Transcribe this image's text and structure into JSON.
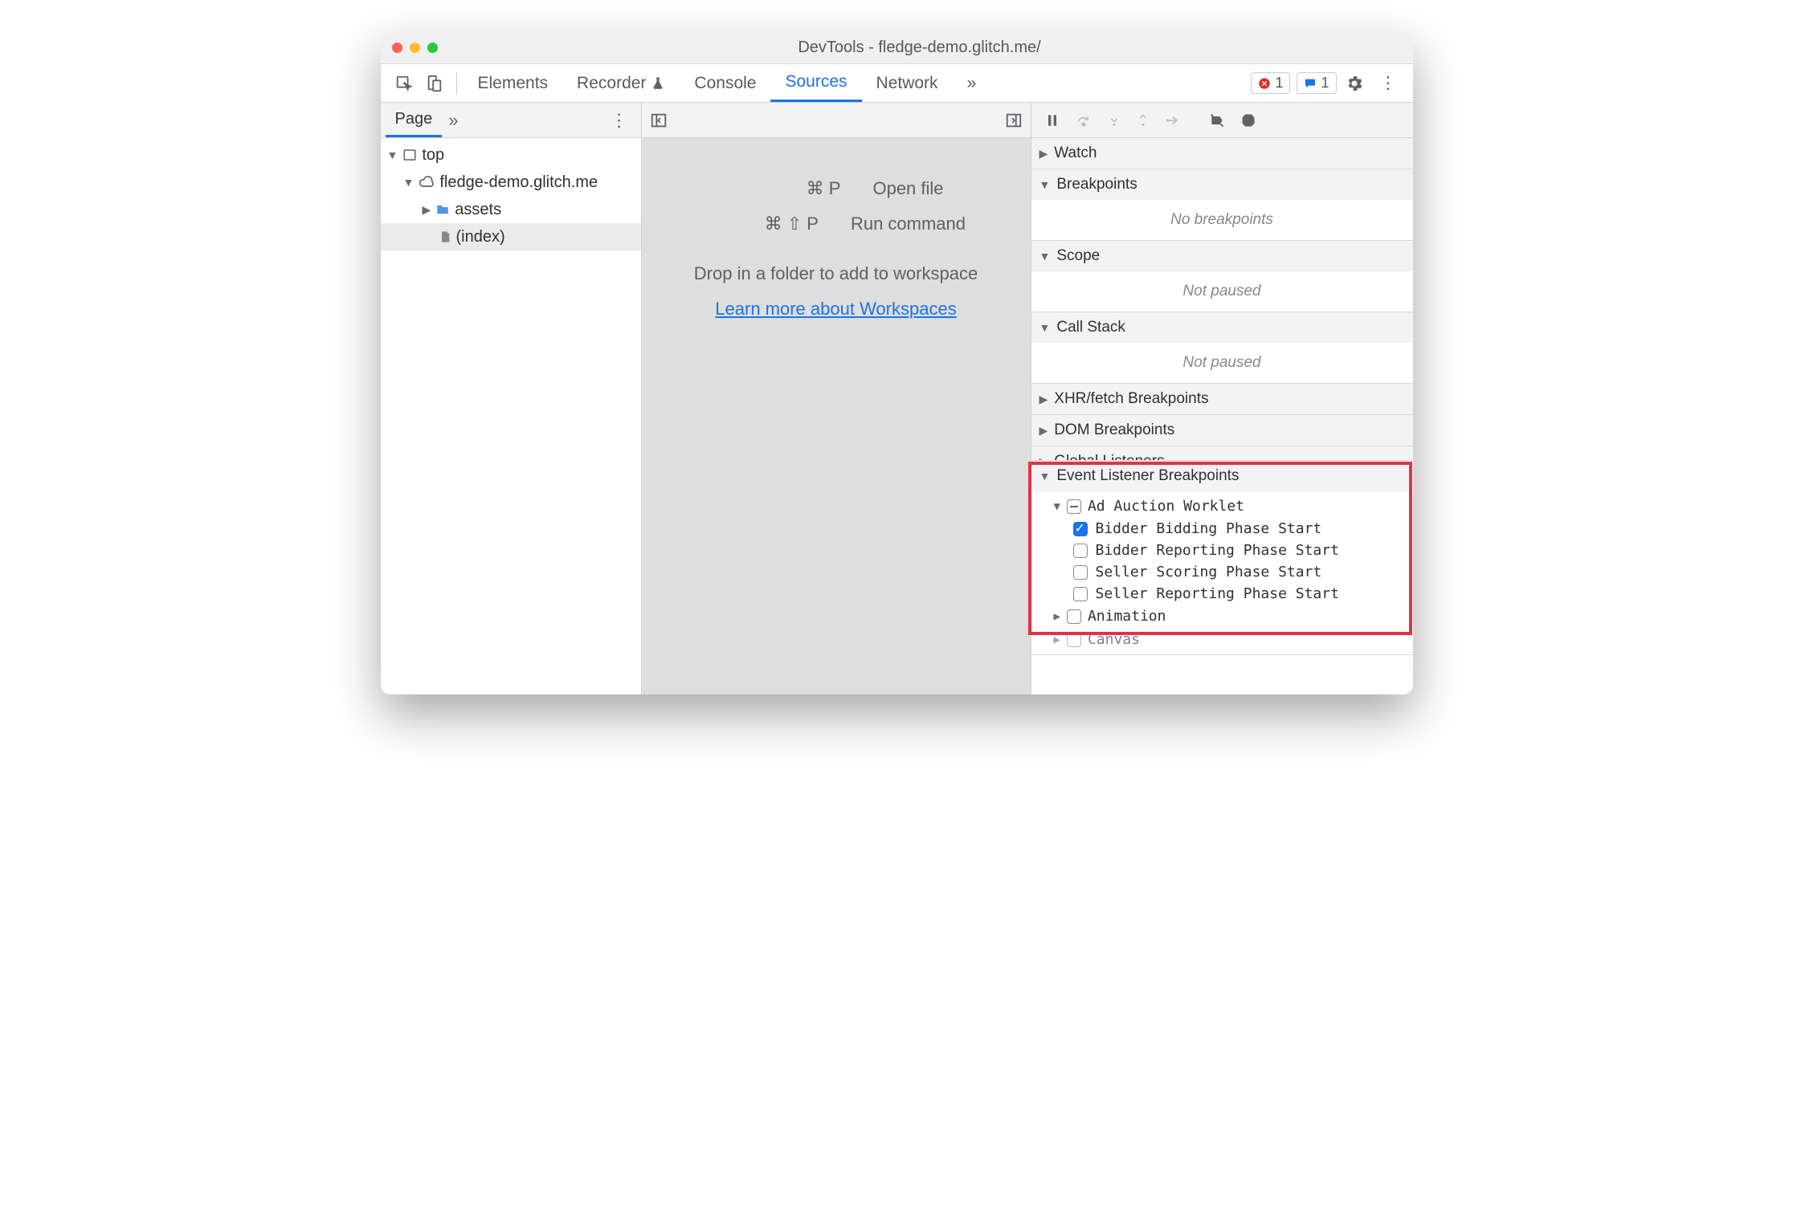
{
  "title": "DevTools - fledge-demo.glitch.me/",
  "main_tabs": {
    "elements": "Elements",
    "recorder": "Recorder",
    "console": "Console",
    "sources": "Sources",
    "network": "Network"
  },
  "badges": {
    "errors": "1",
    "messages": "1"
  },
  "left": {
    "tab_page": "Page",
    "tree": {
      "top": "top",
      "domain": "fledge-demo.glitch.me",
      "assets": "assets",
      "index": "(index)"
    }
  },
  "middle": {
    "open_keys": "⌘ P",
    "open_label": "Open file",
    "run_keys": "⌘ ⇧ P",
    "run_label": "Run command",
    "drop_text": "Drop in a folder to add to workspace",
    "learn_link": "Learn more about Workspaces"
  },
  "right": {
    "watch": "Watch",
    "breakpoints": "Breakpoints",
    "no_breakpoints": "No breakpoints",
    "scope": "Scope",
    "not_paused": "Not paused",
    "callstack": "Call Stack",
    "xhr": "XHR/fetch Breakpoints",
    "dom": "DOM Breakpoints",
    "global": "Global Listeners",
    "elb": "Event Listener Breakpoints",
    "category": "Ad Auction Worklet",
    "items": [
      {
        "label": "Bidder Bidding Phase Start",
        "checked": true
      },
      {
        "label": "Bidder Reporting Phase Start",
        "checked": false
      },
      {
        "label": "Seller Scoring Phase Start",
        "checked": false
      },
      {
        "label": "Seller Reporting Phase Start",
        "checked": false
      }
    ],
    "animation": "Animation",
    "canvas": "Canvas"
  }
}
